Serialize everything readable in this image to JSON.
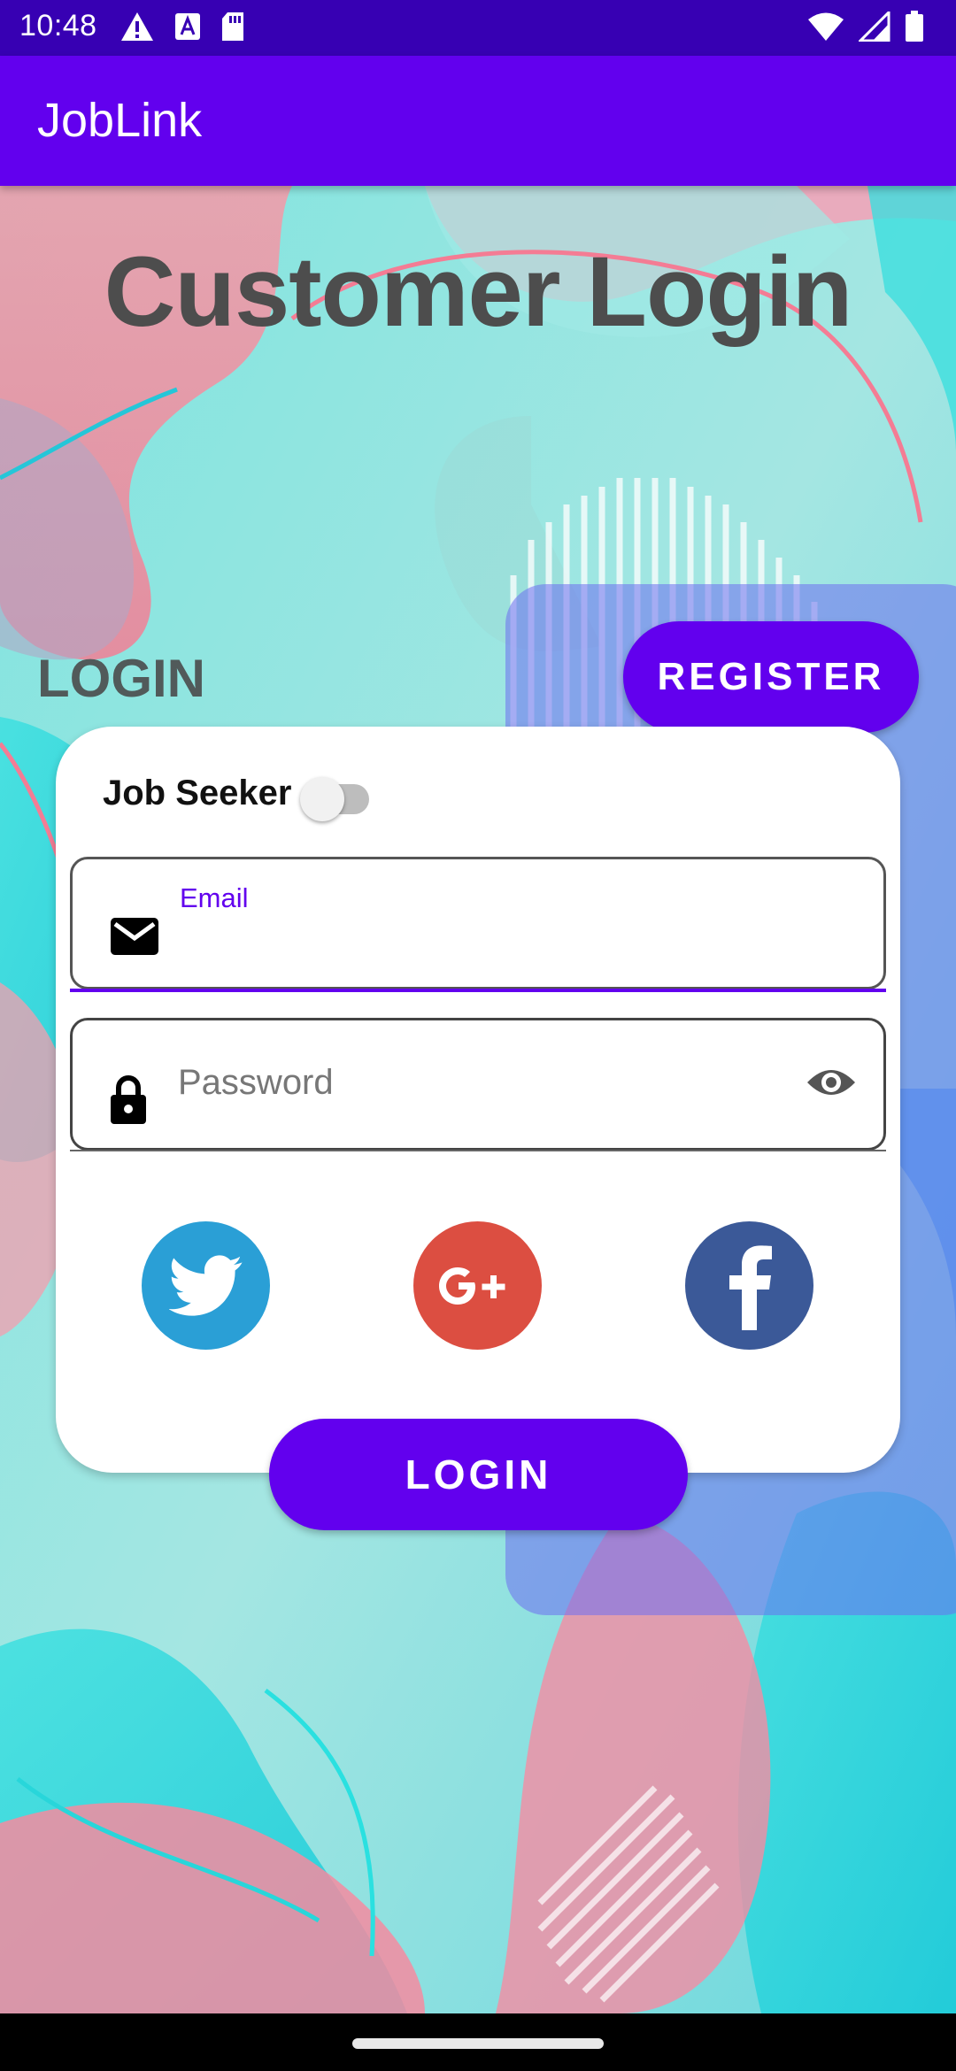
{
  "status_bar": {
    "time": "10:48",
    "left_icons": [
      "alert-icon",
      "font-a-icon",
      "sd-card-icon"
    ],
    "right_icons": [
      "wifi-icon",
      "signal-icon",
      "battery-icon"
    ]
  },
  "app_bar": {
    "title": "JobLink"
  },
  "page": {
    "title": "Customer Login"
  },
  "tabs": {
    "login_label": "LOGIN",
    "register_label": "REGISTER"
  },
  "form": {
    "toggle_label": "Job Seeker",
    "toggle_on": false,
    "email": {
      "label": "Email",
      "value": ""
    },
    "password": {
      "placeholder": "Password",
      "value": ""
    }
  },
  "social": {
    "buttons": [
      {
        "name": "twitter",
        "color": "#2A9FD6"
      },
      {
        "name": "google-plus",
        "color": "#DC4E41"
      },
      {
        "name": "facebook",
        "color": "#3B5998"
      }
    ]
  },
  "actions": {
    "login_label": "LOGIN"
  },
  "colors": {
    "primary": "#6200EE",
    "primary_dark": "#3700B3"
  }
}
